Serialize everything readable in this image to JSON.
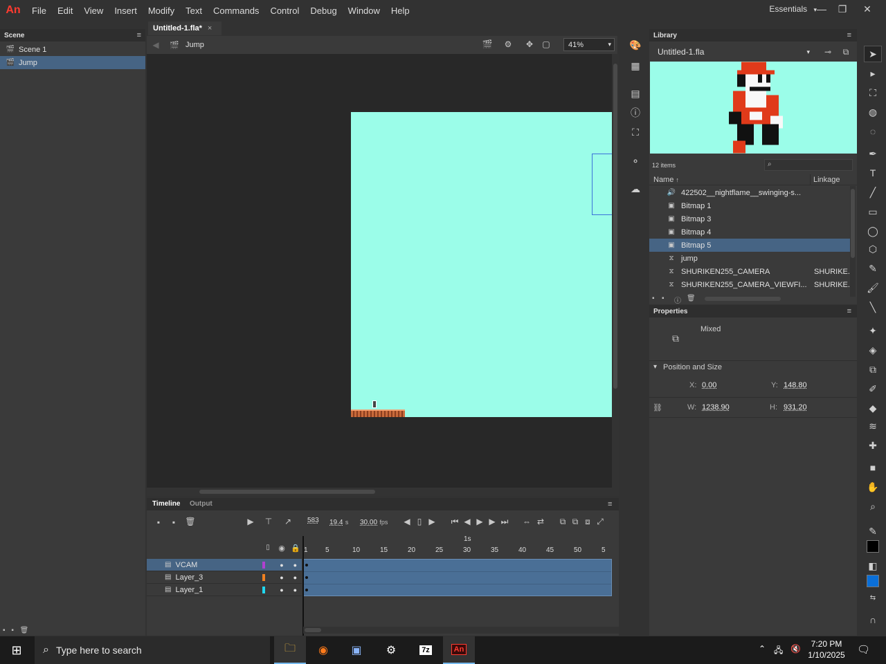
{
  "app": {
    "logo": "An",
    "menu": [
      "File",
      "Edit",
      "View",
      "Insert",
      "Modify",
      "Text",
      "Commands",
      "Control",
      "Debug",
      "Window",
      "Help"
    ],
    "workspace": "Essentials",
    "workspace_caret": "▾"
  },
  "scene_panel": {
    "title": "Scene",
    "scenes": [
      {
        "label": "Scene 1",
        "selected": false
      },
      {
        "label": "Jump",
        "selected": true
      }
    ]
  },
  "document": {
    "tab_title": "Untitled-1.fla*",
    "close": "×",
    "breadcrumb": "Jump",
    "zoom": "41%"
  },
  "timeline": {
    "tabs": [
      "Timeline",
      "Output"
    ],
    "current_frame": "583",
    "elapsed": "19.4",
    "elapsed_unit": "s",
    "fps": "30.00",
    "fps_unit": "fps",
    "ruler_marker": "1s",
    "ruler_numbers": [
      "1",
      "5",
      "10",
      "15",
      "20",
      "25",
      "30",
      "35",
      "40",
      "45",
      "50",
      "5"
    ],
    "layers": [
      {
        "name": "VCAM",
        "color": "#b040d0",
        "selected": true
      },
      {
        "name": "Layer_3",
        "color": "#f08020",
        "selected": false
      },
      {
        "name": "Layer_1",
        "color": "#20d8f0",
        "selected": false
      }
    ]
  },
  "library": {
    "title": "Library",
    "document": "Untitled-1.fla",
    "item_count": "12 items",
    "columns": {
      "name": "Name",
      "linkage": "Linkage"
    },
    "items": [
      {
        "icon": "sound-icon",
        "name": "422502__nightflame__swinging-s...",
        "linkage": "",
        "selected": false
      },
      {
        "icon": "bitmap-icon",
        "name": "Bitmap 1",
        "linkage": "",
        "selected": false
      },
      {
        "icon": "bitmap-icon",
        "name": "Bitmap 3",
        "linkage": "",
        "selected": false
      },
      {
        "icon": "bitmap-icon",
        "name": "Bitmap 4",
        "linkage": "",
        "selected": false
      },
      {
        "icon": "bitmap-icon",
        "name": "Bitmap 5",
        "linkage": "",
        "selected": true
      },
      {
        "icon": "movieclip-icon",
        "name": "jump",
        "linkage": "",
        "selected": false
      },
      {
        "icon": "movieclip-icon",
        "name": "SHURIKEN255_CAMERA",
        "linkage": "SHURIKE.",
        "selected": false
      },
      {
        "icon": "movieclip-icon",
        "name": "SHURIKEN255_CAMERA_VIEWFI...",
        "linkage": "SHURIKE.",
        "selected": false
      }
    ]
  },
  "properties": {
    "title": "Properties",
    "instance_type": "Mixed",
    "section": "Position and Size",
    "x_label": "X:",
    "x": "0.00",
    "y_label": "Y:",
    "y": "148.80",
    "w_label": "W:",
    "w": "1238.90",
    "h_label": "H:",
    "h": "931.20"
  },
  "taskbar": {
    "search_placeholder": "Type here to search",
    "time": "7:20 PM",
    "date": "1/10/2025"
  },
  "colors": {
    "stage": "#9bfde9",
    "selection": "#466484",
    "fill_color": "#0a6fd8",
    "stroke_color": "#000000"
  }
}
